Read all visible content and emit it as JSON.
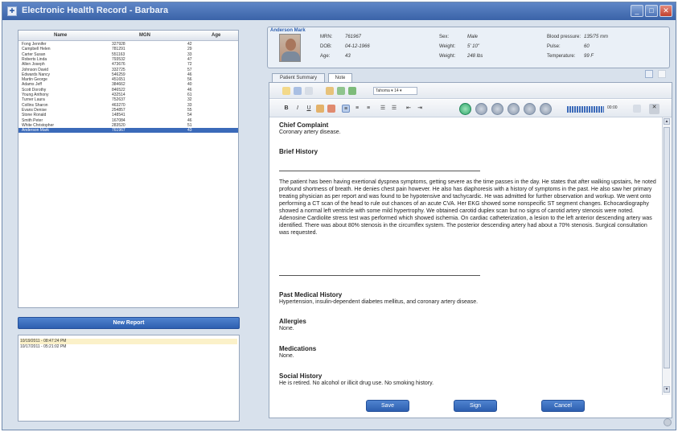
{
  "window": {
    "title": "Electronic Health Record - Barbara",
    "title_icon": "app-icon",
    "controls": [
      "minimize-icon",
      "maximize-icon",
      "close-icon"
    ]
  },
  "patient_list": {
    "headers": [
      "Name",
      "MGN",
      "Age"
    ],
    "rows": [
      [
        "Fong Jennifer",
        "327928",
        "42"
      ],
      [
        "Campbell Helen",
        "781291",
        "29"
      ],
      [
        "Carter Susan",
        "551163",
        "33"
      ],
      [
        "Roberts Linda",
        "793532",
        "47"
      ],
      [
        "Allen Joseph",
        "473676",
        "72"
      ],
      [
        "Johnson David",
        "332725",
        "57"
      ],
      [
        "Edwards Nancy",
        "546259",
        "46"
      ],
      [
        "Martin George",
        "451651",
        "56"
      ],
      [
        "Adams Jeff",
        "384662",
        "40"
      ],
      [
        "Scott Dorothy",
        "846522",
        "46"
      ],
      [
        "Young Anthony",
        "432514",
        "61"
      ],
      [
        "Turner Laura",
        "752637",
        "32"
      ],
      [
        "Collins Sharon",
        "463270",
        "33"
      ],
      [
        "Evans Denise",
        "254857",
        "55"
      ],
      [
        "Stone Ronald",
        "148541",
        "54"
      ],
      [
        "Smith Peter",
        "167084",
        "46"
      ],
      [
        "White Christopher",
        "283520",
        "51"
      ],
      [
        "Anderson Mark",
        "761967",
        "43"
      ]
    ],
    "selected_index": 17
  },
  "new_report_label": "New Report",
  "reports": [
    "10/19/2011 - 08:47:24 PM",
    "10/17/2011 - 05:21:02 PM"
  ],
  "patient": {
    "name": "Anderson Mark",
    "fields": [
      {
        "label": "MRN:",
        "value": "761967"
      },
      {
        "label": "DOB:",
        "value": "04-12-1966"
      },
      {
        "label": "Age:",
        "value": "43"
      },
      {
        "label": "Sex:",
        "value": "Male"
      },
      {
        "label": "Weight:",
        "value": "5' 10\""
      },
      {
        "label": "Weight:",
        "value": "248 lbs"
      },
      {
        "label": "Blood pressure:",
        "value": "135/75 mm"
      },
      {
        "label": "Pulse:",
        "value": "60"
      },
      {
        "label": "Temperature:",
        "value": "99 F"
      }
    ]
  },
  "tabs": [
    {
      "label": "Patient Summary",
      "active": false
    },
    {
      "label": "Note",
      "active": true
    }
  ],
  "toolbar": {
    "font": "Tahoma ▾ 14 ▾",
    "bold": "B",
    "italic": "I",
    "underline": "U",
    "time": "00:00"
  },
  "note": {
    "sections": [
      {
        "heading": "Chief Complaint",
        "text": "Coronary artery disease."
      },
      {
        "heading": "Brief History",
        "text": ""
      },
      {
        "heading": "",
        "text": "The patient has been having exertional dyspnea symptoms, getting severe as the time passes in the day.  He states that after walking upstairs, he noted profound shortness of breath.  He denies chest pain however.  He also has diaphoresis with a history of symptoms in the past.  He also saw her primary treating physician as per report and was found to be hypotensive and tachycardic.  He was admitted for further observation and workup.  We went onto performing a CT scan of the head to rule out chances of an acute CVA.  Her EKG showed some nonspecific ST segment changes.  Echocardiography showed a normal left ventricle with some mild hypertrophy.  We obtained carotid duplex scan but no signs of carotid artery stenosis were noted.  Adenosine Cardiolite stress test was performed which showed ischemia.  On cardiac catheterization, a lesion to the left anterior descending artery was identified.  There was about 80% stenosis in the circumflex system.  The posterior descending artery had about a 70% stenosis.  Surgical consultation was requested."
      },
      {
        "heading": "Past Medical History",
        "text": "Hypertension, insulin-dependent diabetes mellitus, and coronary artery disease."
      },
      {
        "heading": "Allergies",
        "text": "None."
      },
      {
        "heading": "Medications",
        "text": "None."
      },
      {
        "heading": "Social History",
        "text": "He is retired.  No alcohol or illicit drug use.  No smoking history."
      }
    ]
  },
  "actions": {
    "save": "Save",
    "sign": "Sign",
    "cancel": "Cancel"
  },
  "colors": {
    "accent": "#2d5fb0",
    "selection": "#3b6ab9",
    "window_bg": "#d8e1ec"
  }
}
